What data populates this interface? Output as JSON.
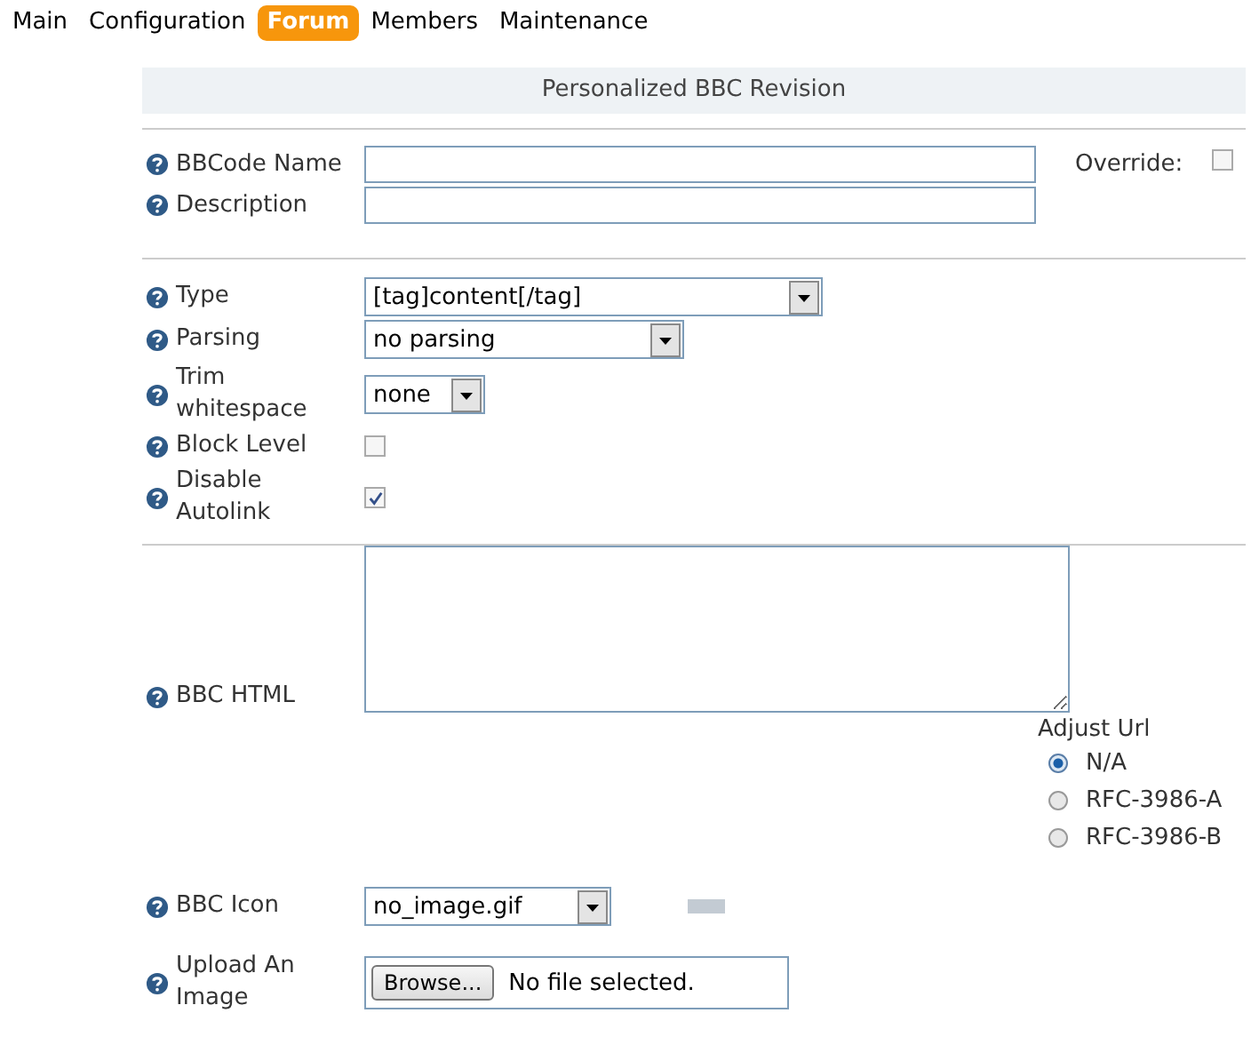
{
  "tabs": [
    {
      "label": "Main",
      "selected": false
    },
    {
      "label": "Configuration",
      "selected": false
    },
    {
      "label": "Forum",
      "selected": true
    },
    {
      "label": "Members",
      "selected": false
    },
    {
      "label": "Maintenance",
      "selected": false
    }
  ],
  "panel_title": "Personalized BBC Revision",
  "sections": [
    [
      {
        "kind": "text",
        "label": "BBCode Name",
        "override": {
          "label": "Override:",
          "checked": false
        }
      },
      {
        "kind": "text",
        "label": "Description"
      }
    ],
    [
      {
        "kind": "select",
        "label": "Type",
        "value": "[tag]content[/tag]"
      },
      {
        "kind": "select",
        "label": "Parsing",
        "value": "no parsing"
      },
      {
        "kind": "select",
        "label": "Trim whitespace",
        "value": "none"
      },
      {
        "kind": "checkbox",
        "label": "Block Level",
        "checked": false
      },
      {
        "kind": "checkbox",
        "label": "Disable Autolink",
        "checked": true
      }
    ],
    [
      {
        "kind": "textarea",
        "label": "BBC HTML",
        "adjust": {
          "title": "Adjust Url",
          "options": [
            {
              "label": "N/A",
              "selected": true
            },
            {
              "label": "RFC-3986-A",
              "selected": false
            },
            {
              "label": "RFC-3986-B",
              "selected": false
            }
          ]
        }
      },
      {
        "kind": "icon-select",
        "label": "BBC Icon",
        "value": "no_image.gif"
      },
      {
        "kind": "file",
        "label": "Upload An Image",
        "button": "Browse...",
        "status": "No file selected."
      }
    ]
  ]
}
